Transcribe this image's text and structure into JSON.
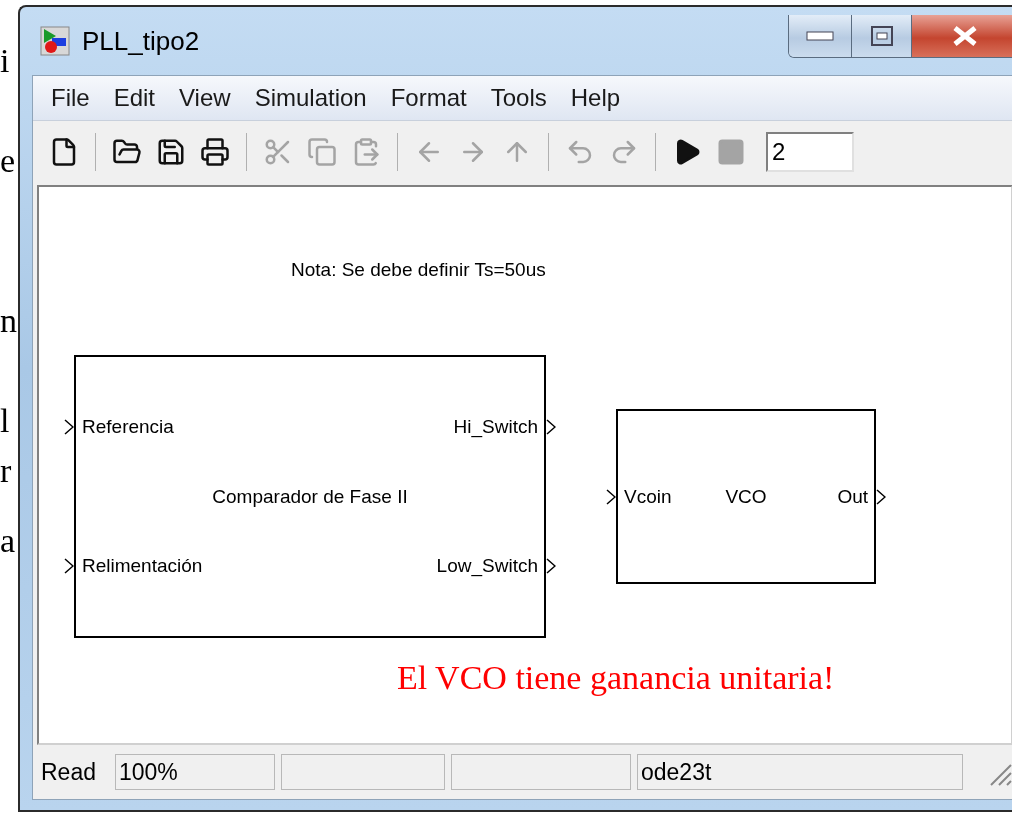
{
  "background_document": {
    "fragments": [
      "i",
      "e",
      "n",
      "l",
      "r",
      "a"
    ]
  },
  "window": {
    "title": "PLL_tipo2"
  },
  "menu": [
    "File",
    "Edit",
    "View",
    "Simulation",
    "Format",
    "Tools",
    "Help"
  ],
  "toolbar": {
    "items": [
      {
        "kind": "new",
        "disabled": false
      },
      {
        "kind": "separator"
      },
      {
        "kind": "open",
        "disabled": false
      },
      {
        "kind": "save",
        "disabled": false
      },
      {
        "kind": "print",
        "disabled": false
      },
      {
        "kind": "separator"
      },
      {
        "kind": "cut",
        "disabled": true
      },
      {
        "kind": "copy",
        "disabled": true
      },
      {
        "kind": "paste",
        "disabled": true
      },
      {
        "kind": "separator"
      },
      {
        "kind": "back",
        "disabled": true
      },
      {
        "kind": "forward",
        "disabled": true
      },
      {
        "kind": "up",
        "disabled": true
      },
      {
        "kind": "separator"
      },
      {
        "kind": "undo",
        "disabled": true
      },
      {
        "kind": "redo",
        "disabled": true
      },
      {
        "kind": "separator"
      },
      {
        "kind": "play",
        "disabled": false
      },
      {
        "kind": "stop",
        "disabled": true
      }
    ],
    "stop_time": "2"
  },
  "diagram": {
    "annotation": "Nota: Se debe definir Ts=50us",
    "blocks": [
      {
        "title": "Comparador de Fase II",
        "inputs": [
          "Referencia",
          "Relimentación"
        ],
        "outputs": [
          "Hi_Switch",
          "Low_Switch"
        ]
      },
      {
        "title": "VCO",
        "inputs": [
          "Vcoin"
        ],
        "outputs": [
          "Out"
        ]
      }
    ],
    "comment": "El VCO tiene ganancia unitaria!"
  },
  "status_bar": {
    "state": "Read",
    "zoom": "100%",
    "solver": "ode23t"
  }
}
